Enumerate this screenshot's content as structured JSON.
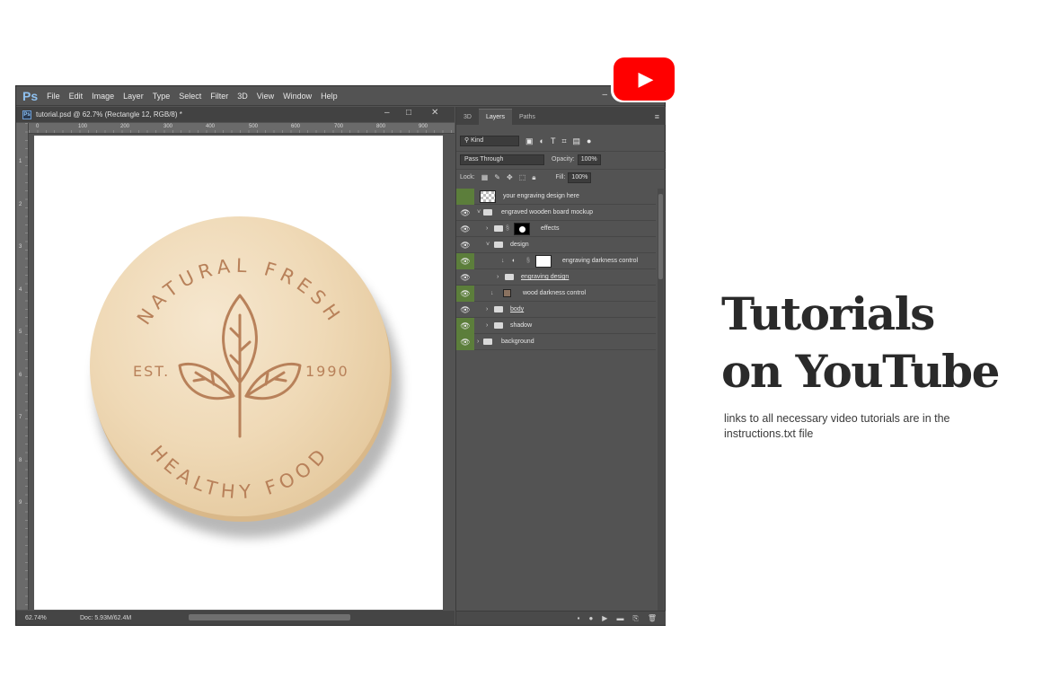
{
  "app": {
    "logo": "Ps",
    "menu": [
      "File",
      "Edit",
      "Image",
      "Layer",
      "Type",
      "Select",
      "Filter",
      "3D",
      "View",
      "Window",
      "Help"
    ],
    "minimize": "–"
  },
  "document": {
    "icon": "Ps",
    "title": "tutorial.psd @ 62.7% (Rectangle 12, RGB/8) *",
    "controls": {
      "minimize": "–",
      "restore": "□",
      "close": "✕"
    },
    "ruler_top": [
      "0",
      "100",
      "200",
      "300",
      "400",
      "500",
      "600",
      "700",
      "800",
      "900"
    ],
    "ruler_left": [
      "1",
      "2",
      "3",
      "4",
      "5",
      "6",
      "7",
      "8",
      "9"
    ],
    "zoom": "62.74%",
    "doc_size": "Doc: 5.93M/62.4M"
  },
  "artwork": {
    "top_text": "NATURAL FRESH",
    "bottom_text": "HEALTHY FOOD",
    "left_text": "EST.",
    "right_text": "1990",
    "engrave_color": "#b8815a"
  },
  "panel": {
    "tabs": [
      "3D",
      "Layers",
      "Paths"
    ],
    "active_tab": "Layers",
    "filter_kind": "Kind",
    "blend_mode": "Pass Through",
    "opacity_label": "Opacity:",
    "opacity_value": "100%",
    "lock_label": "Lock:",
    "fill_label": "Fill:",
    "fill_value": "100%",
    "layers": [
      {
        "name": "your engraving design here",
        "visible": false
      },
      {
        "name": "engraved wooden board mockup",
        "visible": true
      },
      {
        "name": "effects",
        "visible": true
      },
      {
        "name": "design",
        "visible": true
      },
      {
        "name": "engraving darkness control",
        "visible": true
      },
      {
        "name": "engraving design",
        "visible": true
      },
      {
        "name": "wood darkness control",
        "visible": true
      },
      {
        "name": "body",
        "visible": true
      },
      {
        "name": "shadow",
        "visible": true
      },
      {
        "name": "background",
        "visible": true
      }
    ],
    "accent": "#5c7e3b"
  },
  "promo": {
    "headline_line1": "Tutorials",
    "headline_line2": "on YouTube",
    "subtitle": "links to all necessary video tutorials are in the instructions.txt file",
    "youtube_color": "#ff0000"
  }
}
